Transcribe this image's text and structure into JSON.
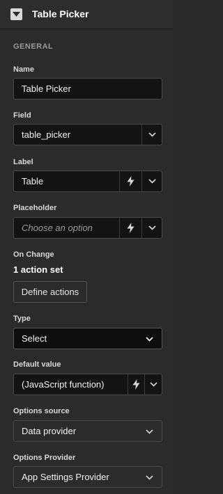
{
  "header": {
    "title": "Table Picker",
    "collapse_icon": "triangle-down-icon"
  },
  "section": {
    "title": "GENERAL"
  },
  "fields": {
    "name": {
      "label": "Name",
      "value": "Table Picker"
    },
    "field": {
      "label": "Field",
      "value": "table_picker"
    },
    "label": {
      "label": "Label",
      "value": "Table"
    },
    "placeholder": {
      "label": "Placeholder",
      "placeholder": "Choose an option"
    },
    "on_change": {
      "label": "On Change",
      "summary": "1 action set",
      "button": "Define actions"
    },
    "type": {
      "label": "Type",
      "value": "Select"
    },
    "default_value": {
      "label": "Default value",
      "value": "(JavaScript function)"
    },
    "options_source": {
      "label": "Options source",
      "value": "Data provider"
    },
    "options_provider": {
      "label": "Options Provider",
      "value": "App Settings Provider"
    }
  },
  "colors": {
    "background": "#2b2b2b",
    "input_bg": "#131313",
    "border": "#4a4a4a",
    "text": "#e6e6e6"
  }
}
